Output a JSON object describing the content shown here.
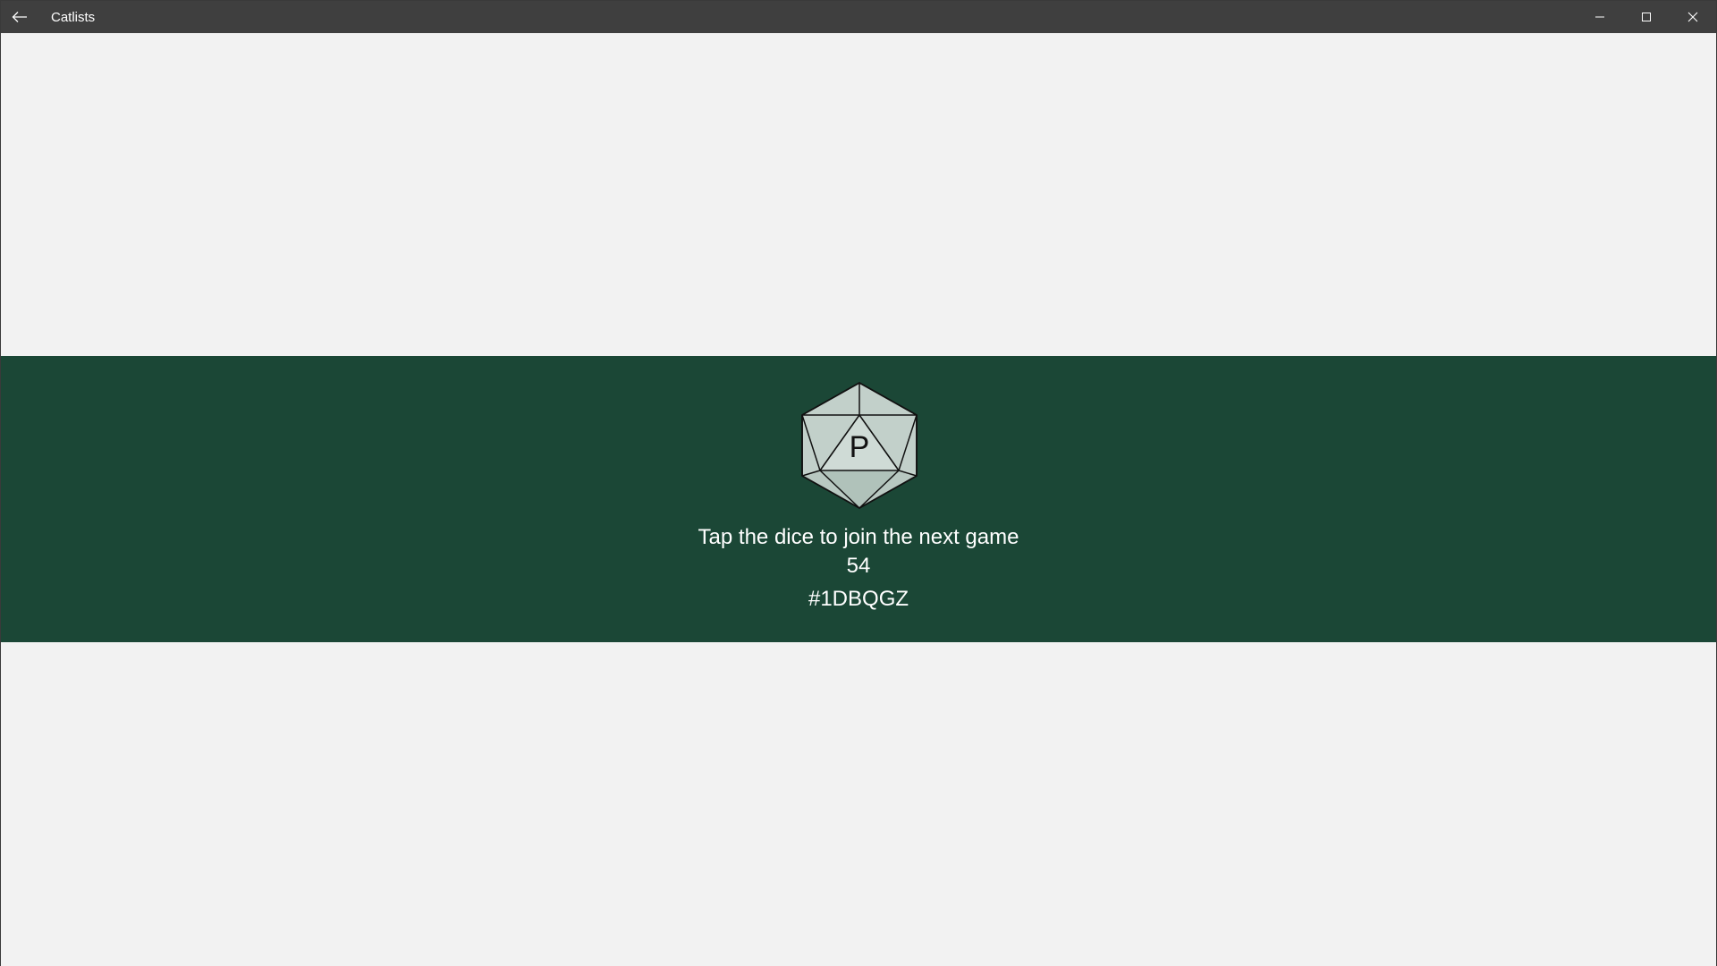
{
  "window": {
    "title": "Catlists",
    "back_icon": "arrow-left-icon",
    "minimize_icon": "minimize-icon",
    "maximize_icon": "maximize-icon",
    "close_icon": "close-icon"
  },
  "colors": {
    "titlebar": "#3f3f3f",
    "background": "#f2f2f2",
    "band": "#1b4736",
    "dice_fill": "#c2d0ca",
    "dice_shade": "#b0c2ba",
    "text": "#ffffff"
  },
  "game": {
    "dice_letter": "P",
    "dice_icon": "d20-dice-icon",
    "prompt": "Tap the dice to join the next game",
    "count": "54",
    "code": "#1DBQGZ"
  }
}
